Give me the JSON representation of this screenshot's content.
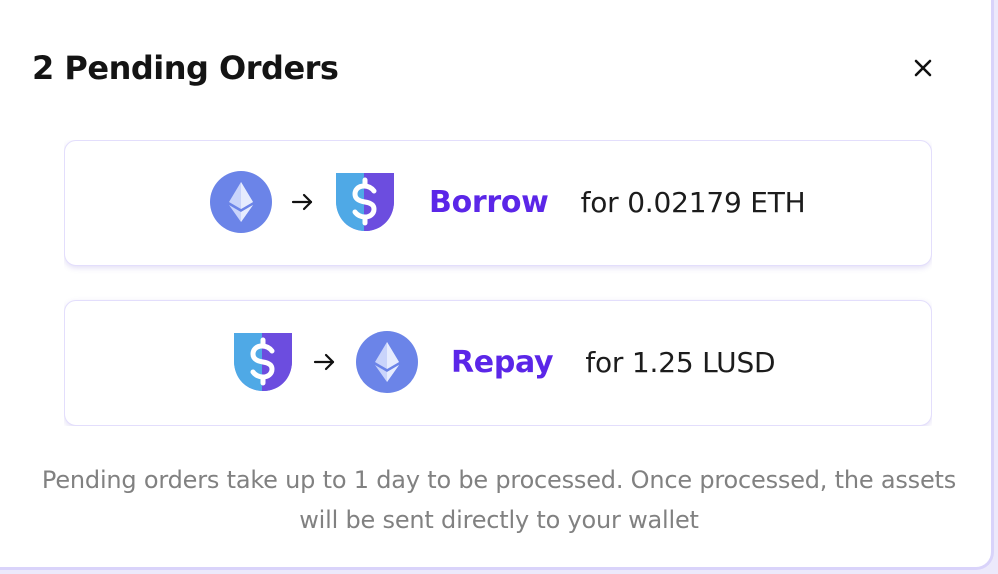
{
  "modal": {
    "title": "2 Pending Orders",
    "close_icon": "close-icon",
    "footer_text": "Pending orders take up to 1 day to be processed. Once processed, the assets will be sent directly to your wallet"
  },
  "orders": [
    {
      "from_icon": "eth-icon",
      "arrow_icon": "arrow-right-icon",
      "to_icon": "lusd-icon",
      "action": "Borrow",
      "amount_text": "for 0.02179 ETH"
    },
    {
      "from_icon": "lusd-icon",
      "arrow_icon": "arrow-right-icon",
      "to_icon": "eth-icon",
      "action": "Repay",
      "amount_text": "for 1.25 LUSD"
    }
  ],
  "colors": {
    "accent": "#5b26e8",
    "eth_circle": "#6b84e8",
    "lusd_light": "#4fa9e6",
    "lusd_dark": "#6c4ddf",
    "footer_text": "#818181",
    "card_border": "#e3defc"
  }
}
